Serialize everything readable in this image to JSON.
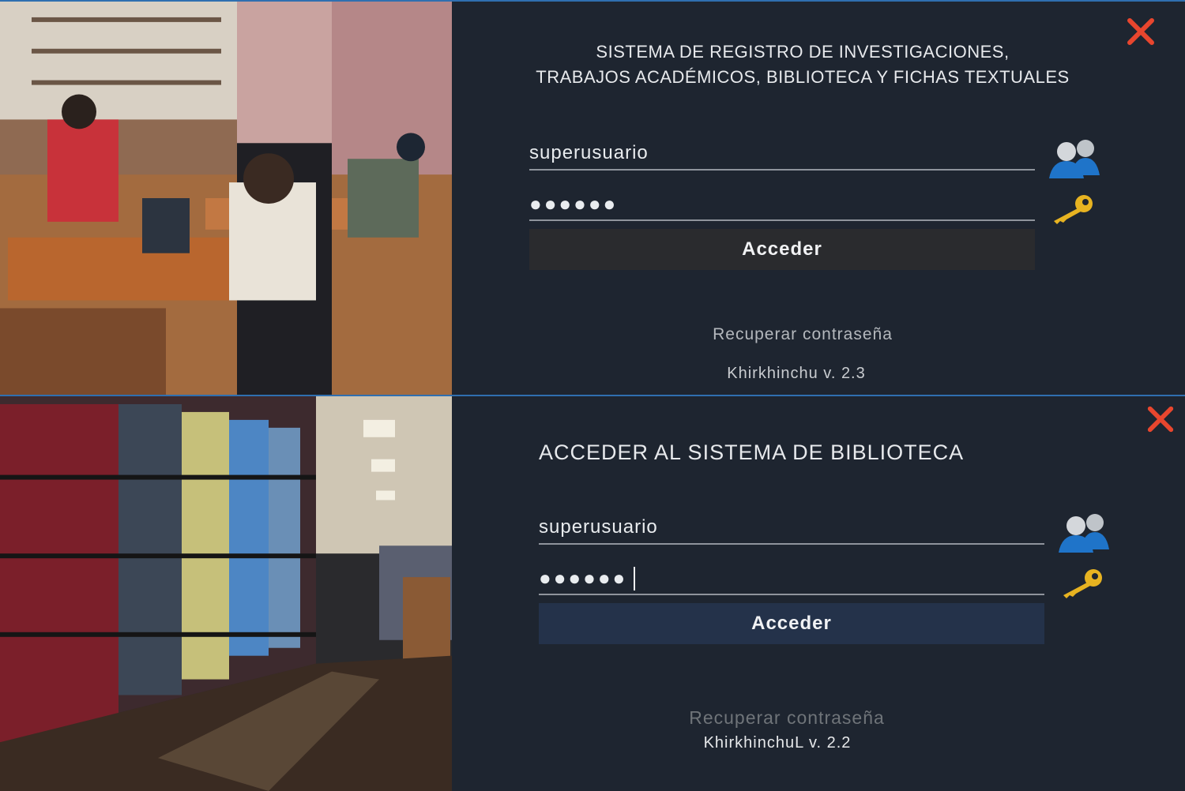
{
  "top": {
    "title_line1": "SISTEMA DE REGISTRO DE INVESTIGACIONES,",
    "title_line2": "TRABAJOS ACADÉMICOS, BIBLIOTECA Y FICHAS TEXTUALES",
    "username_value": "superusuario",
    "password_value": "●●●●●●",
    "submit_label": "Acceder",
    "recover_link": "Recuperar contraseña",
    "version": "Khirkhinchu v. 2.3",
    "icons": {
      "user": "users-icon",
      "password": "key-icon",
      "close": "close-icon"
    }
  },
  "bottom": {
    "title": "ACCEDER AL SISTEMA DE BIBLIOTECA",
    "username_value": "superusuario",
    "password_value": "●●●●●●",
    "submit_label": "Acceder",
    "recover_link": "Recuperar contraseña",
    "version": "KhirkhinchuL v. 2.2",
    "icons": {
      "user": "users-icon",
      "password": "key-icon",
      "close": "close-icon"
    }
  },
  "colors": {
    "panel_bg": "#1e2530",
    "close_red": "#e8462e",
    "accent_border": "#2f6fb0",
    "key_yellow": "#e7b321",
    "user_blue": "#1f74c9"
  }
}
